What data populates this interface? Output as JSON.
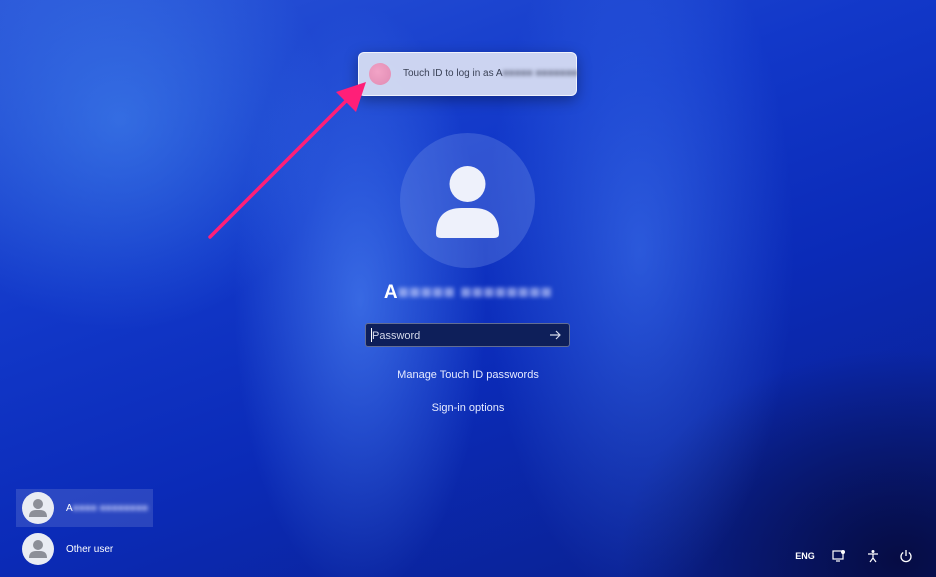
{
  "touch_toast": {
    "text": "Touch ID to log in as A",
    "blurred": "■■■■■ ■■■■■■■"
  },
  "user": {
    "name_initial": "A",
    "name_blurred": "■■■■■ ■■■■■■■■"
  },
  "password": {
    "placeholder": "Password"
  },
  "links": {
    "manage": "Manage Touch ID passwords",
    "signin_options": "Sign-in options"
  },
  "accounts": [
    {
      "initial": "A",
      "blurred": "■■■■ ■■■■■■■■",
      "selected": true
    },
    {
      "label": "Other user",
      "selected": false
    }
  ],
  "tray": {
    "language": "ENG"
  },
  "icons": {
    "toast": "fingerprint-icon",
    "submit": "arrow-right-icon",
    "network": "network-icon",
    "accessibility": "accessibility-icon",
    "power": "power-icon"
  },
  "colors": {
    "arrow": "#ff1f78",
    "field_bg": "#0e1f5a"
  }
}
